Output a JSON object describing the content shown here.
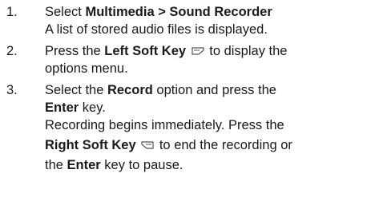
{
  "steps": [
    {
      "number": "1.",
      "action_prefix": "Select ",
      "action_bold": "Multimedia > Sound Recorder",
      "result": "A list of stored audio files is displayed."
    },
    {
      "number": "2.",
      "prefix": "Press the ",
      "key_bold": "Left Soft Key",
      "icon": "left-soft-key-icon",
      "suffix_line1": " to display the",
      "line2": "options menu."
    },
    {
      "number": "3.",
      "line1_prefix": "Select the ",
      "option_bold": "Record",
      "line1_suffix": " option and press the",
      "enter_bold": "Enter",
      "line2_suffix": " key.",
      "result_line1": "Recording begins immediately. Press the",
      "right_key_bold": "Right Soft Key",
      "right_icon": "right-soft-key-icon",
      "result_line2_suffix": " to end the recording or",
      "line5_prefix": "the ",
      "enter_bold_2": "Enter",
      "line5_suffix": " key to pause."
    }
  ]
}
